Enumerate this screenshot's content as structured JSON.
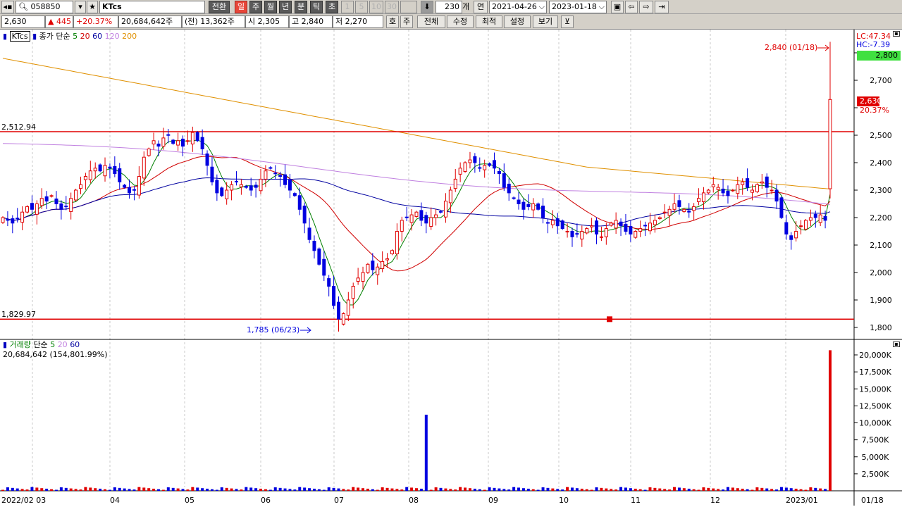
{
  "toolbar": {
    "code": "058850",
    "name": "KTcs",
    "tabs": [
      "전환",
      "일",
      "주",
      "월",
      "년",
      "분",
      "틱",
      "초"
    ],
    "intervals": [
      "1",
      "5",
      "10",
      "30"
    ],
    "count": "230",
    "count_unit": "개",
    "year_label": "연",
    "date_from": "2021-04-26",
    "date_to": "2023-01-18"
  },
  "quote": {
    "price": "2,630",
    "change": "▲ 445",
    "pct": "+20.37%",
    "volume": "20,684,642주",
    "prev": "(전) 13,362주",
    "open": "시 2,305",
    "high": "고 2,840",
    "low": "저 2,270",
    "buttons": [
      "호",
      "주",
      "전체",
      "수정",
      "최적",
      "설정",
      "보기"
    ]
  },
  "price_panel": {
    "title": "KTcs",
    "ma_label": "종가 단순",
    "ma_periods": [
      "5",
      "20",
      "60",
      "120",
      "200"
    ],
    "ma_colors": [
      "#008000",
      "#d00000",
      "#0000a0",
      "#c080e0",
      "#e09000"
    ],
    "lc": "LC:47.34",
    "hc": "HC:-7.39",
    "y_ticks": [
      "2,800",
      "2,700",
      "2,600",
      "2,500",
      "2,400",
      "2,300",
      "2,200",
      "2,100",
      "2,000",
      "1,900",
      "1,800"
    ],
    "current_price_box": "2,630",
    "current_pct": "20.37%",
    "high_box": "2,800",
    "hline_upper": "2,512.94",
    "hline_lower": "1,829.97",
    "high_annotation": "2,840 (01/18)",
    "low_annotation": "1,785 (06/23)"
  },
  "volume_panel": {
    "label": "거래량",
    "ma_label": "단순",
    "ma_periods": [
      "5",
      "20",
      "60"
    ],
    "info": "20,684,642 (154,801.99%)",
    "y_ticks": [
      "20,000K",
      "17,500K",
      "15,000K",
      "12,500K",
      "10,000K",
      "7,500K",
      "5,000K",
      "2,500K"
    ]
  },
  "x_axis": [
    "2022/02 03",
    "04",
    "05",
    "06",
    "07",
    "08",
    "09",
    "10",
    "11",
    "12",
    "2023/01",
    "01/18"
  ],
  "colors": {
    "up": "#e00000",
    "down": "#0000e0",
    "hline": "#e00000",
    "accent_box": "#40e040",
    "price_box": "#e00000"
  },
  "chart_data": {
    "type": "candlestick",
    "period": "daily",
    "x_range": [
      "2022-02-03",
      "2023-01-18"
    ],
    "ylim": [
      1785,
      2840
    ],
    "last_bar": {
      "date": "2023-01-18",
      "open": 2305,
      "high": 2840,
      "low": 2270,
      "close": 2630,
      "volume": 20684642
    },
    "extremes": {
      "high": {
        "value": 2840,
        "date": "01/18"
      },
      "low": {
        "value": 1785,
        "date": "06/23"
      }
    },
    "closes_approx": [
      2200,
      2190,
      2180,
      2195,
      2220,
      2240,
      2230,
      2250,
      2270,
      2260,
      2280,
      2250,
      2230,
      2240,
      2270,
      2300,
      2320,
      2350,
      2370,
      2380,
      2370,
      2390,
      2380,
      2360,
      2330,
      2310,
      2290,
      2300,
      2350,
      2420,
      2450,
      2480,
      2460,
      2490,
      2500,
      2470,
      2480,
      2460,
      2480,
      2510,
      2480,
      2450,
      2390,
      2330,
      2290,
      2280,
      2300,
      2320,
      2330,
      2320,
      2310,
      2300,
      2310,
      2340,
      2370,
      2380,
      2360,
      2350,
      2320,
      2300,
      2280,
      2230,
      2180,
      2120,
      2080,
      2030,
      1990,
      1950,
      1880,
      1830,
      1850,
      1900,
      1950,
      1980,
      2000,
      2030,
      2010,
      2020,
      2040,
      2050,
      2080,
      2150,
      2190,
      2200,
      2210,
      2220,
      2190,
      2180,
      2200,
      2210,
      2220,
      2260,
      2300,
      2340,
      2380,
      2400,
      2410,
      2400,
      2380,
      2390,
      2390,
      2380,
      2360,
      2310,
      2290,
      2270,
      2250,
      2230,
      2240,
      2250,
      2230,
      2200,
      2180,
      2190,
      2170,
      2160,
      2150,
      2130,
      2140,
      2150,
      2160,
      2170,
      2140,
      2130,
      2160,
      2180,
      2190,
      2170,
      2150,
      2140,
      2150,
      2160,
      2170,
      2180,
      2190,
      2200,
      2220,
      2230,
      2250,
      2240,
      2230,
      2220,
      2240,
      2270,
      2290,
      2300,
      2320,
      2310,
      2290,
      2280,
      2300,
      2320,
      2330,
      2310,
      2300,
      2320,
      2330,
      2310,
      2300,
      2260,
      2200,
      2140,
      2120,
      2150,
      2170,
      2190,
      2200,
      2200,
      2210,
      2190,
      2630
    ],
    "volume_peak": {
      "value": 20684642,
      "date": "01/18"
    },
    "volume_secondary_peak_approx": 11200000,
    "ma_periods": [
      5,
      20,
      60,
      120,
      200
    ],
    "horizontal_lines": [
      2512.94,
      1829.97
    ]
  }
}
